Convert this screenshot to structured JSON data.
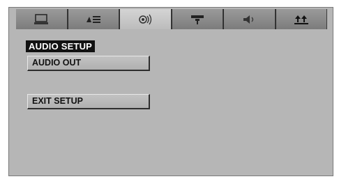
{
  "tabs": [
    {
      "icon": "monitor-icon"
    },
    {
      "icon": "settings-list-icon"
    },
    {
      "icon": "speaker-waves-icon",
      "active": true
    },
    {
      "icon": "tv-video-icon"
    },
    {
      "icon": "volume-icon"
    },
    {
      "icon": "exit-arrows-icon"
    }
  ],
  "panel": {
    "title": "AUDIO SETUP"
  },
  "menu": {
    "audio_out_label": "AUDIO OUT",
    "exit_setup_label": "EXIT SETUP"
  },
  "colors": {
    "background": "#b6b6b6",
    "active_tab": "#c8c8c8",
    "title_bg": "#111111"
  }
}
